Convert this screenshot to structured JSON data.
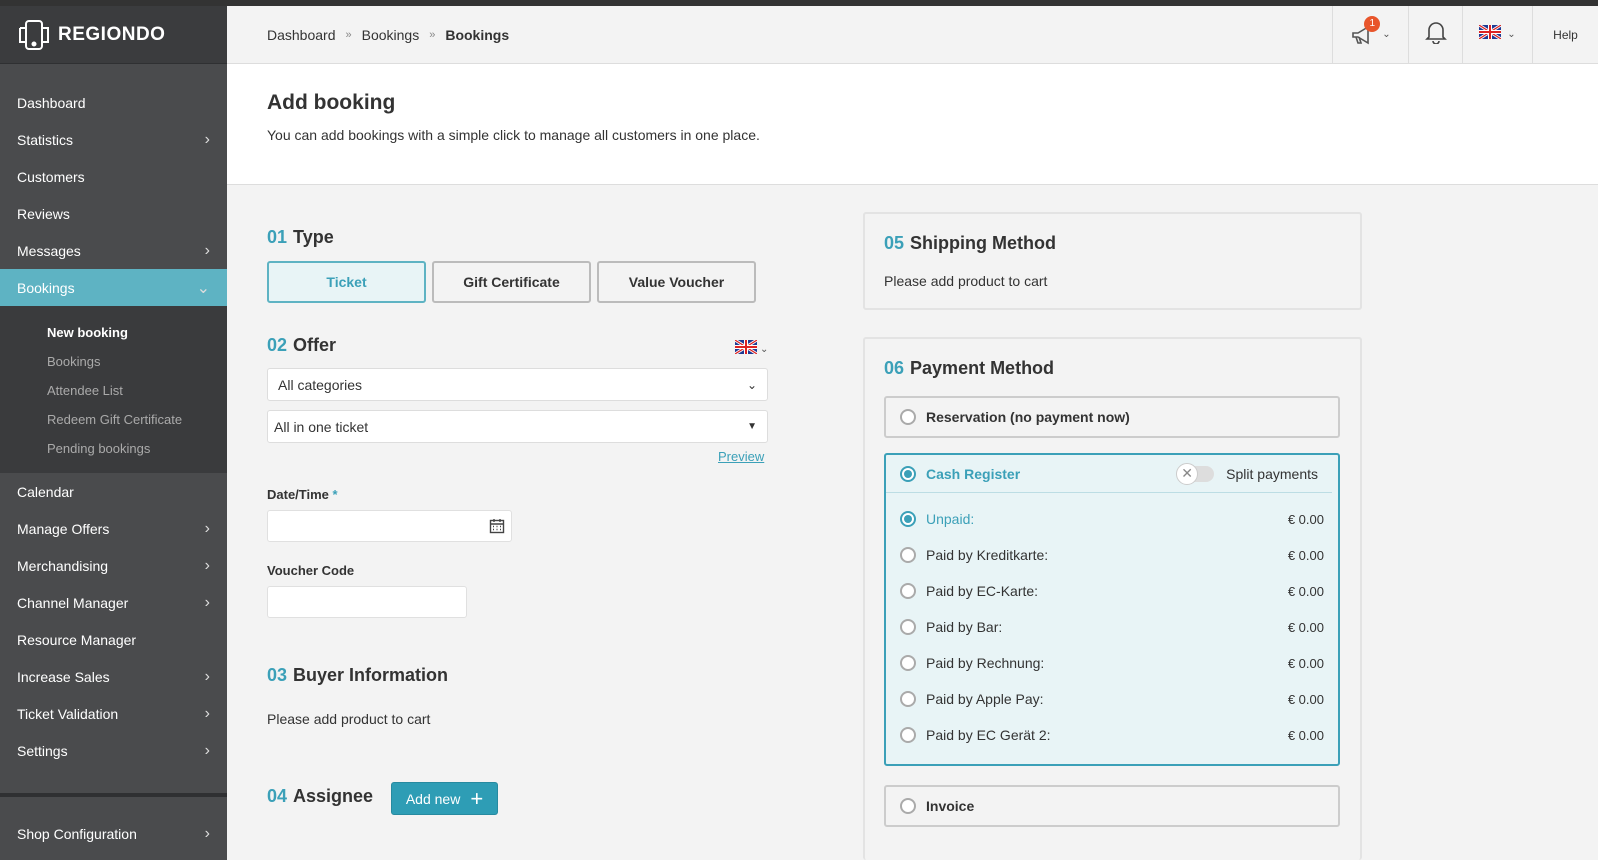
{
  "brand": {
    "name": "REGIONDO"
  },
  "breadcrumb": [
    "Dashboard",
    "Bookings",
    "Bookings"
  ],
  "header": {
    "notification_count": "1",
    "help_label": "Help"
  },
  "sidebar": {
    "items": [
      {
        "label": "Dashboard",
        "chevron": false
      },
      {
        "label": "Statistics",
        "chevron": true
      },
      {
        "label": "Customers",
        "chevron": false
      },
      {
        "label": "Reviews",
        "chevron": false
      },
      {
        "label": "Messages",
        "chevron": true
      },
      {
        "label": "Bookings",
        "chevron": true,
        "active": true
      }
    ],
    "subitems": [
      "New booking",
      "Bookings",
      "Attendee List",
      "Redeem Gift Certificate",
      "Pending bookings"
    ],
    "items_after": [
      {
        "label": "Calendar",
        "chevron": false
      },
      {
        "label": "Manage Offers",
        "chevron": true
      },
      {
        "label": "Merchandising",
        "chevron": true
      },
      {
        "label": "Channel Manager",
        "chevron": true
      },
      {
        "label": "Resource Manager",
        "chevron": false
      },
      {
        "label": "Increase Sales",
        "chevron": true
      },
      {
        "label": "Ticket Validation",
        "chevron": true
      },
      {
        "label": "Settings",
        "chevron": true
      }
    ],
    "shop_config": "Shop Configuration"
  },
  "page": {
    "title": "Add booking",
    "subtitle": "You can add bookings with a simple click to manage all customers in one place."
  },
  "type_section": {
    "num": "01",
    "title": "Type",
    "options": [
      "Ticket",
      "Gift Certificate",
      "Value Voucher"
    ],
    "selected": "Ticket"
  },
  "offer_section": {
    "num": "02",
    "title": "Offer",
    "category_select": "All categories",
    "offer_select": "All in one ticket",
    "preview_link": "Preview",
    "datetime_label": "Date/Time",
    "required_mark": "*",
    "voucher_label": "Voucher Code"
  },
  "buyer_section": {
    "num": "03",
    "title": "Buyer Information",
    "empty_text": "Please add product to cart"
  },
  "assignee_section": {
    "num": "04",
    "title": "Assignee",
    "add_button": "Add new"
  },
  "shipping_section": {
    "num": "05",
    "title": "Shipping Method",
    "empty_text": "Please add product to cart"
  },
  "payment_section": {
    "num": "06",
    "title": "Payment Method",
    "reservation": "Reservation (no payment now)",
    "cash_register": "Cash Register",
    "split_payments": "Split payments",
    "rows": [
      {
        "label": "Unpaid:",
        "amount": "€ 0.00",
        "selected": true
      },
      {
        "label": "Paid by Kreditkarte:",
        "amount": "€ 0.00"
      },
      {
        "label": "Paid by EC-Karte:",
        "amount": "€ 0.00"
      },
      {
        "label": "Paid by Bar:",
        "amount": "€ 0.00"
      },
      {
        "label": "Paid by Rechnung:",
        "amount": "€ 0.00"
      },
      {
        "label": "Paid by Apple Pay:",
        "amount": "€ 0.00"
      },
      {
        "label": "Paid by EC Gerät 2:",
        "amount": "€ 0.00"
      }
    ],
    "invoice": "Invoice"
  },
  "colors": {
    "accent": "#5eb3c3",
    "accent_dark": "#2e9db5",
    "sidebar": "#4a4b4d",
    "notification": "#e8552b"
  },
  "icons": [
    "regiondo-logo-icon",
    "megaphone-icon",
    "bell-icon",
    "uk-flag-icon",
    "calendar-icon",
    "plus-icon",
    "chevron-right-icon",
    "chevron-down-icon"
  ]
}
